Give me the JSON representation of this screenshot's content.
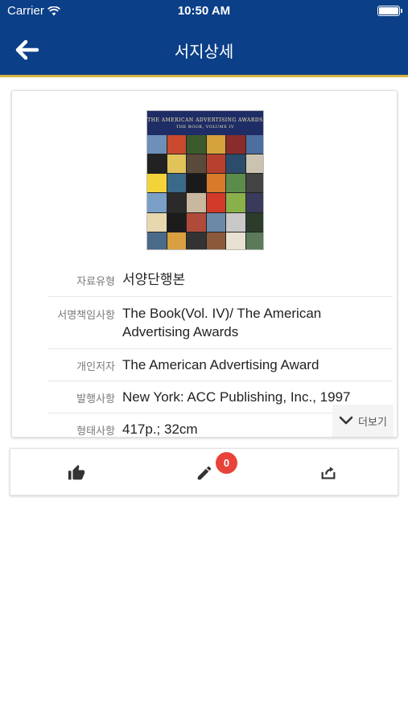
{
  "status_bar": {
    "carrier": "Carrier",
    "time": "10:50 AM"
  },
  "header": {
    "title": "서지상세"
  },
  "book": {
    "cover_title": "THE AMERICAN ADVERTISING AWARDS",
    "cover_subtitle": "THE BOOK, VOLUME IV",
    "fields": [
      {
        "label": "자료유형",
        "value": "서양단행본"
      },
      {
        "label": "서명책임사항",
        "value": "The Book(Vol. IV)/ The American Advertising Awards"
      },
      {
        "label": "개인저자",
        "value": "The American Advertising Award"
      },
      {
        "label": "발행사항",
        "value": "New York: ACC Publishing, Inc., 1997"
      },
      {
        "label": "형태사항",
        "value": "417p.; 32cm"
      }
    ],
    "more_label": "더보기"
  },
  "actions": {
    "comment_count": "0"
  },
  "icons": [
    "back-arrow-icon",
    "wifi-icon",
    "battery-icon",
    "thumbs-up-icon",
    "pencil-icon",
    "share-icon",
    "chevron-down-icon"
  ],
  "colors": {
    "header": "#0b3f87",
    "header_border": "#d6b341",
    "badge": "#e8423a"
  }
}
